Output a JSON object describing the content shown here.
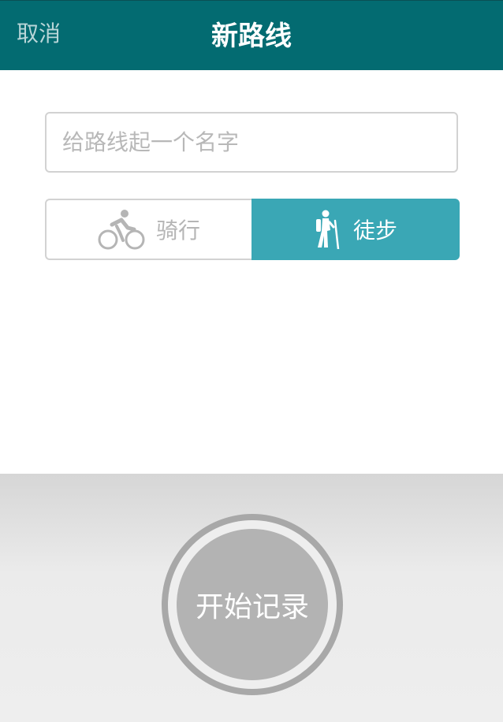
{
  "header": {
    "cancel_label": "取消",
    "title": "新路线"
  },
  "form": {
    "name_placeholder": "给路线起一个名字",
    "name_value": ""
  },
  "mode_toggle": {
    "options": [
      {
        "label": "骑行",
        "icon": "cycling-icon",
        "selected": false
      },
      {
        "label": "徒步",
        "icon": "hiking-icon",
        "selected": true
      }
    ]
  },
  "record": {
    "label": "开始记录"
  },
  "colors": {
    "header_bg": "#036b71",
    "accent": "#3aa7b5",
    "record_gray": "#b3b3b3"
  }
}
